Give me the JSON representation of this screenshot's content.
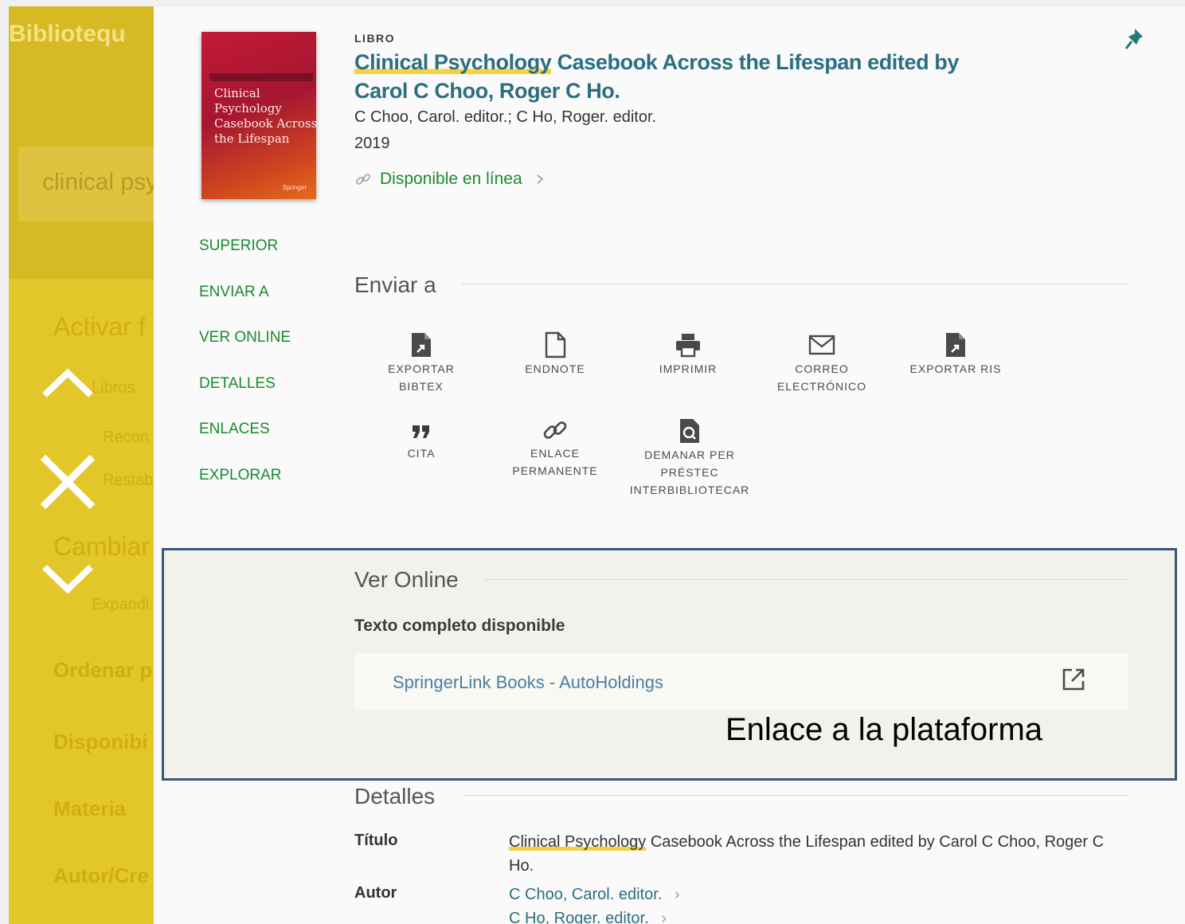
{
  "background_panel": {
    "logo_text": "Bibliotequ",
    "search_text": "clinical psy",
    "activar": "Activar f",
    "libros": "Libros",
    "recon": "Recon",
    "restab": "Restab",
    "cambiar": "Cambiar",
    "expand": "Expandi",
    "ordenar": "Ordenar p",
    "disponib": "Disponibi",
    "materia": "Materia",
    "autor": "Autor/Cre"
  },
  "record": {
    "type": "LIBRO",
    "title_highlight": "Clinical Psychology",
    "title_rest": " Casebook Across the Lifespan edited by Carol C Choo, Roger C Ho.",
    "authors": "C Choo, Carol. editor.; C Ho, Roger. editor.",
    "year": "2019",
    "availability": "Disponible en línea"
  },
  "cover": {
    "title": "Clinical\nPsychology\nCasebook Across\nthe Lifespan",
    "publisher": "Springer"
  },
  "nav": [
    "SUPERIOR",
    "ENVIAR A",
    "VER ONLINE",
    "DETALLES",
    "ENLACES",
    "EXPLORAR"
  ],
  "send_to": {
    "title": "Enviar a",
    "actions": [
      {
        "label": "EXPORTAR\nBIBTEX",
        "icon": "file-export-icon"
      },
      {
        "label": "ENDNOTE",
        "icon": "file-icon"
      },
      {
        "label": "IMPRIMIR",
        "icon": "printer-icon"
      },
      {
        "label": "CORREO\nELECTRÓNICO",
        "icon": "envelope-icon"
      },
      {
        "label": "EXPORTAR RIS",
        "icon": "file-export-icon"
      },
      {
        "label": "CITA",
        "icon": "quote-icon"
      },
      {
        "label": "ENLACE\nPERMANENTE",
        "icon": "link-icon"
      },
      {
        "label": "DEMANAR PER\nPRÉSTEC\nINTERBIBLIOTECAR",
        "icon": "file-search-icon"
      }
    ]
  },
  "view_online": {
    "title": "Ver Online",
    "fulltext_label": "Texto completo disponible",
    "link_text": "SpringerLink Books - AutoHoldings",
    "annotation": "Enlace a la plataforma"
  },
  "details": {
    "title": "Detalles",
    "title_label": "Título",
    "title_highlight": "Clinical Psychology",
    "title_rest": " Casebook Across the Lifespan edited by Carol C Choo, Roger C Ho.",
    "author_label": "Autor",
    "author_1": "C Choo, Carol. editor.",
    "author_2": "C Ho, Roger. editor."
  },
  "colors": {
    "accent_green": "#1a8a2e",
    "title_teal": "#2c6e80",
    "highlight_yellow": "#f4d33f",
    "panel_yellow": "#e3c72a",
    "frame_blue": "#3b5778"
  }
}
